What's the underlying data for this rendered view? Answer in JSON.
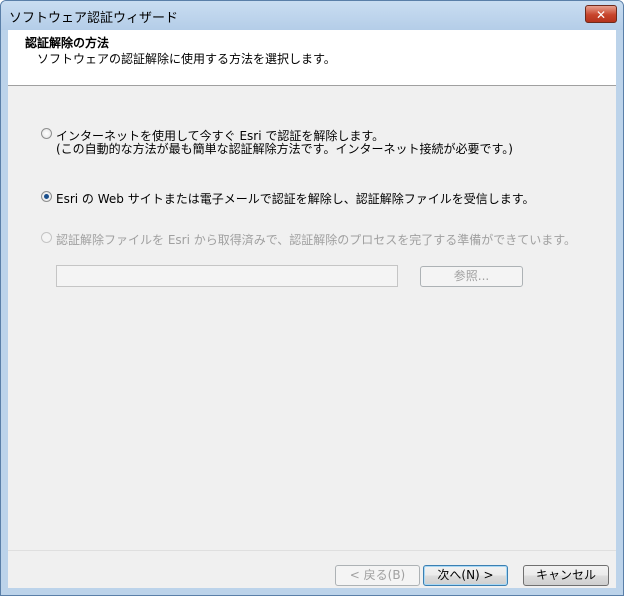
{
  "window": {
    "title": "ソフトウェア認証ウィザード",
    "close_label": "✕"
  },
  "header": {
    "title": "認証解除の方法",
    "subtitle": "ソフトウェアの認証解除に使用する方法を選択します。"
  },
  "options": [
    {
      "line1": "インターネットを使用して今すぐ Esri で認証を解除します。",
      "line2": "(この自動的な方法が最も簡単な認証解除方法です。インターネット接続が必要です。)",
      "selected": false,
      "enabled": true
    },
    {
      "line1": "Esri の Web サイトまたは電子メールで認証を解除し、認証解除ファイルを受信します。",
      "selected": true,
      "enabled": true
    },
    {
      "line1": "認証解除ファイルを Esri から取得済みで、認証解除のプロセスを完了する準備ができています。",
      "selected": false,
      "enabled": false
    }
  ],
  "file_path": {
    "value": ""
  },
  "browse_label": "参照...",
  "footer": {
    "back_label": "< 戻る(B)",
    "next_label": "次へ(N) >",
    "cancel_label": "キャンセル"
  }
}
